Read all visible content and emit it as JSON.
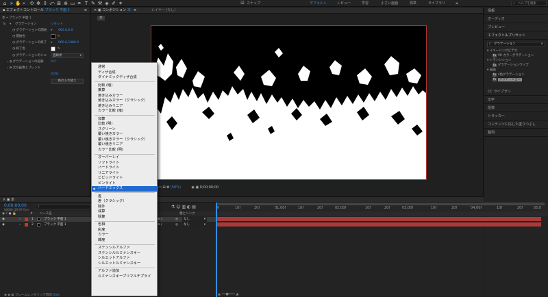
{
  "toolbar": {
    "snap": "スナップ",
    "workspaces": [
      "デフォルト",
      "レビュー",
      "学習",
      "小さい画面",
      "標準",
      "ライブラリ"
    ],
    "search_placeholder": "ヘルプを検索"
  },
  "left_panel": {
    "tab": "エフェクトコントロール",
    "tab_layer": "ブラック 平面 1",
    "breadcrumb": "本 • ブラック 平面 1",
    "effect_name": "グラデーション",
    "reset": "リセット",
    "rows": [
      {
        "label": "グラデーションの開始",
        "value": "960.0,0.0"
      },
      {
        "label": "開始色",
        "value": ""
      },
      {
        "label": "グラデーションの終了",
        "value": "960.0,1080.0"
      },
      {
        "label": "終了色",
        "value": ""
      },
      {
        "label": "グラデーションのシェ",
        "value": "直線状"
      },
      {
        "label": "グラデーションの拡散",
        "value": "0.0"
      },
      {
        "label": "元の画像とブレンド",
        "value": "0.0%"
      }
    ],
    "swap_button": "色の入れ替え"
  },
  "comp_panel": {
    "tab": "コンポジション",
    "tab_name": "本",
    "layer_tab": "レイヤー (なし)",
    "comp_label": "本",
    "zoom": "(50%)",
    "timecode": "0;00;00;00"
  },
  "right_panel": {
    "sections": [
      "情報",
      "オーディオ",
      "プレビュー",
      "エフェクト＆プリセット"
    ],
    "search": "グラデーション",
    "tree": [
      "イメージングビデオ",
      "VR カラーグラデーション",
      "トランジション",
      "グラデーションワイプ",
      "描画",
      "4色グラデーション",
      "グラデーション"
    ],
    "sections2": [
      "CC ライブラリ",
      "文字",
      "段落",
      "トラッカー",
      "コンテンツに応じた塗りつぶし",
      "整列"
    ]
  },
  "timeline": {
    "tab": "本",
    "timecode": "0;00;00;00",
    "fps": "00000 (29.97 fps)",
    "search_placeholder": "",
    "col_source": "ソース名",
    "col_parent": "親とリンク",
    "layers": [
      {
        "num": "1",
        "name": "ブラック 平面 1",
        "parent": "なし"
      },
      {
        "num": "2",
        "name": "ブラック 平面 1",
        "parent": "なし"
      }
    ],
    "ruler": [
      "0f",
      "10f",
      "20f",
      "01;00f",
      "10f",
      "20f",
      "02;00f",
      "10f",
      "20f",
      "03;00f",
      "10f",
      "20f",
      "04;00f",
      "10f",
      "20f",
      "05;0"
    ],
    "footer": "フレームレンダリング時間",
    "footer_value": "0ms"
  },
  "blend_menu": {
    "groups": [
      [
        "通常",
        "ディザ合成",
        "ダイナミックディザ合成"
      ],
      [
        "比較 (暗)",
        "乗算",
        "焼き込みカラー",
        "焼き込みカラー（クラシック）",
        "焼き込みリニア",
        "カラー比較 (暗)"
      ],
      [
        "加算",
        "比較 (明)",
        "スクリーン",
        "覆い焼きカラー",
        "覆い焼きカラー（クラシック）",
        "覆い焼きリニア",
        "カラー比較 (明)"
      ],
      [
        "オーバーレイ",
        "ソフトライト",
        "ハードライト",
        "リニアライト",
        "ビビッドライト",
        "ピンライト",
        "ハードミックス"
      ],
      [
        "差",
        "差（クラシック）",
        "除外",
        "減算",
        "除算"
      ],
      [
        "色相",
        "彩度",
        "カラー",
        "輝度"
      ],
      [
        "ステンシルアルファ",
        "ステンシルルミナンスキー",
        "シルエットアルファ",
        "シルエットルミナンスキー"
      ],
      [
        "アルファ追加",
        "ルミナンスキープリマルチプライ"
      ]
    ],
    "selected": "ハードミックス"
  },
  "colors": {
    "accent": "#2f8fe0",
    "layer_bar": "#a83a3a",
    "menu_selected": "#1e6ad2"
  }
}
